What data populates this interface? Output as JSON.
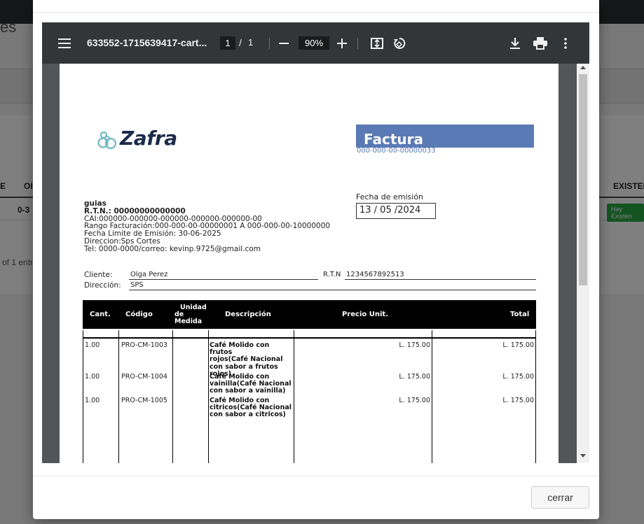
{
  "background": {
    "title_fragment": "es",
    "col_left_fragment": "E",
    "col_code_fragment": "OI",
    "col_right": "EXISTEN",
    "row_code": "0-3",
    "row_badge": "Hay Existen",
    "info_fragment": "of 1 entr"
  },
  "viewer": {
    "menu_icon": "hamburger-menu-icon",
    "file_name": "633552-1715639417-cart...",
    "page_current": "1",
    "page_separator": "/",
    "page_total": "1",
    "zoom": "90%",
    "icons": [
      "zoom-out-icon",
      "zoom-in-icon",
      "fit-page-icon",
      "rotate-icon",
      "download-icon",
      "print-icon",
      "more-options-icon"
    ]
  },
  "invoice": {
    "logo_text": "Zafra",
    "doc_type": "Factura",
    "doc_number": "000-000-00-00000033",
    "fecha_label": "Fecha de emisión",
    "fecha_value": "13 / 05 /2024",
    "company": {
      "name": "guias",
      "rtn": "R.T.N.: 00000000000000",
      "cai": "CAI:000000-000000-000000-000000-000000-00",
      "rango": "Rango Facturación:000-000-00-00000001 A 000-000-00-10000000",
      "fecha_limite": "Fecha Limite de Emisión: 30-06-2025",
      "direccion": "Direccion:Sps Cortes",
      "contacto": "Tel: 0000-0000/correo: kevinp.9725@gmail.com"
    },
    "cliente_label": "Cliente:",
    "cliente_value": "Olga Perez",
    "rtn_label": "R.T.N",
    "rtn_value": "1234567892513",
    "direccion_label": "Dirección:",
    "direccion_value": "SPS",
    "table": {
      "headers": {
        "cant": "Cant.",
        "codigo": "Código",
        "unidad_1": "Unidad",
        "unidad_2": "de",
        "unidad_3": "Medida",
        "descripcion": "Descripción",
        "precio": "Precio Unit.",
        "total": "Total"
      },
      "rows": [
        {
          "cant": "1.00",
          "codigo": "PRO-CM-1003",
          "desc_1": "Café Molido con frutos",
          "desc_2": "rojos(Café Nacional",
          "desc_3": "con sabor a frutos",
          "desc_4": "rojos)",
          "precio": "L. 175.00",
          "total": "L. 175.00"
        },
        {
          "cant": "1.00",
          "codigo": "PRO-CM-1004",
          "desc_1": "Café Molido con",
          "desc_2": "vainilla(Café Nacional",
          "desc_3": "con sabor a vainilla)",
          "precio": "L. 175.00",
          "total": "L. 175.00"
        },
        {
          "cant": "1.00",
          "codigo": "PRO-CM-1005",
          "desc_1": "Café Molido con",
          "desc_2": "citricos(Café Nacional",
          "desc_3": "con sabor a citricos)",
          "precio": "L. 175.00",
          "total": "L. 175.00"
        }
      ]
    }
  },
  "modal": {
    "close_label": "cerrar"
  },
  "colors": {
    "factura_blue": "#5a7ab5",
    "toolbar": "#323639",
    "viewer_bg": "#525659",
    "logo_navy": "#1c2b4a",
    "logo_teal": "#6fb8c1"
  }
}
